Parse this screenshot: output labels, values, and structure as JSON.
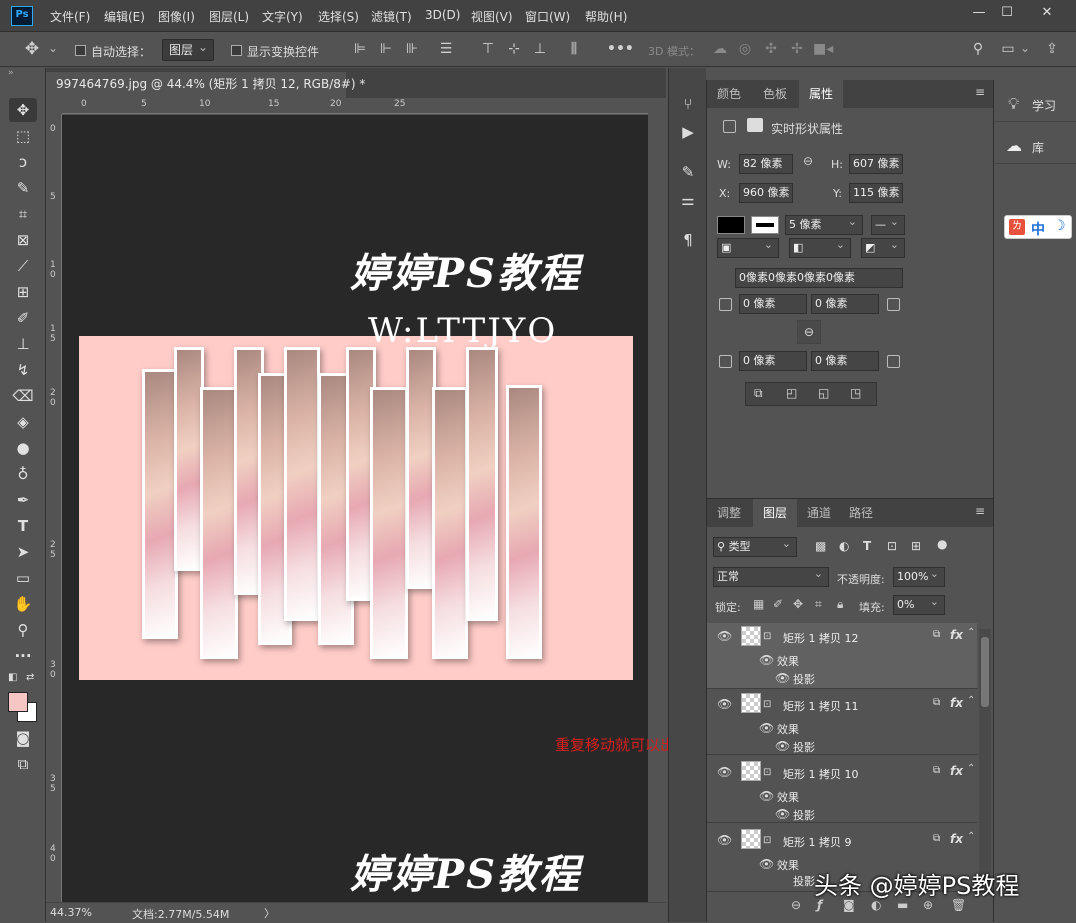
{
  "app": {
    "logo": "Ps"
  },
  "menu": [
    "文件(F)",
    "编辑(E)",
    "图像(I)",
    "图层(L)",
    "文字(Y)",
    "选择(S)",
    "滤镜(T)",
    "3D(D)",
    "视图(V)",
    "窗口(W)",
    "帮助(H)"
  ],
  "window_controls": {
    "min": "—",
    "max": "☐",
    "close": "✕"
  },
  "options": {
    "auto_select_label": "自动选择：",
    "auto_select_target": "图层",
    "show_transform_label": "显示变换控件",
    "mode_3d_label": "3D 模式："
  },
  "document": {
    "tab_title": "997464769.jpg @ 44.4% (矩形 1 拷贝 12, RGB/8#) *",
    "ruler_h": [
      "0",
      "5",
      "10",
      "15",
      "20",
      "25"
    ],
    "ruler_v": [
      "0",
      "5",
      "1",
      "0",
      "1",
      "5",
      "2",
      "0",
      "2",
      "5",
      "3",
      "0",
      "3",
      "5",
      "4",
      "0"
    ],
    "watermark_title": "婷婷PS教程",
    "watermark_sub": "W:LTTJYO",
    "annotation": "重复移动就可以出来你想要的效果哦"
  },
  "status": {
    "zoom": "44.37%",
    "doc_info": "文档:2.77M/5.54M",
    "arrow": "〉"
  },
  "properties": {
    "tabs": [
      "颜色",
      "色板",
      "属性"
    ],
    "active_tab": "属性",
    "title": "实时形状属性",
    "w_label": "W:",
    "w_value": "82 像素",
    "h_label": "H:",
    "h_value": "607 像素",
    "x_label": "X:",
    "x_value": "960 像素",
    "y_label": "Y:",
    "y_value": "115 像素",
    "stroke_width": "5 像素",
    "corner_all": "0像素0像素0像素0像素",
    "corner_tl": "0 像素",
    "corner_tr": "0 像素",
    "corner_bl": "0 像素",
    "corner_br": "0 像素"
  },
  "layers_panel": {
    "tabs": [
      "调整",
      "图层",
      "通道",
      "路径"
    ],
    "active_tab": "图层",
    "filter_kind": "类型",
    "blend_mode": "正常",
    "opacity_label": "不透明度:",
    "opacity_value": "100%",
    "lock_label": "锁定:",
    "fill_label": "填充:",
    "fill_value": "0%",
    "effects_label": "效果",
    "shadow_label": "投影",
    "layers": [
      {
        "name": "矩形 1 拷贝 12",
        "fx": "fx"
      },
      {
        "name": "矩形 1 拷贝 11",
        "fx": "fx"
      },
      {
        "name": "矩形 1 拷贝 10",
        "fx": "fx"
      },
      {
        "name": "矩形 1 拷贝 9",
        "fx": "fx"
      }
    ]
  },
  "right_dock": {
    "learn": "学习",
    "library": "库"
  },
  "ime": {
    "label": "中"
  },
  "watermark_bottom": "头条 @婷婷PS教程",
  "colors": {
    "foreground": "#f5c6c4",
    "background": "#ffffff",
    "annotation": "#d81e1e",
    "canvas_bg": "#ffccc8"
  }
}
